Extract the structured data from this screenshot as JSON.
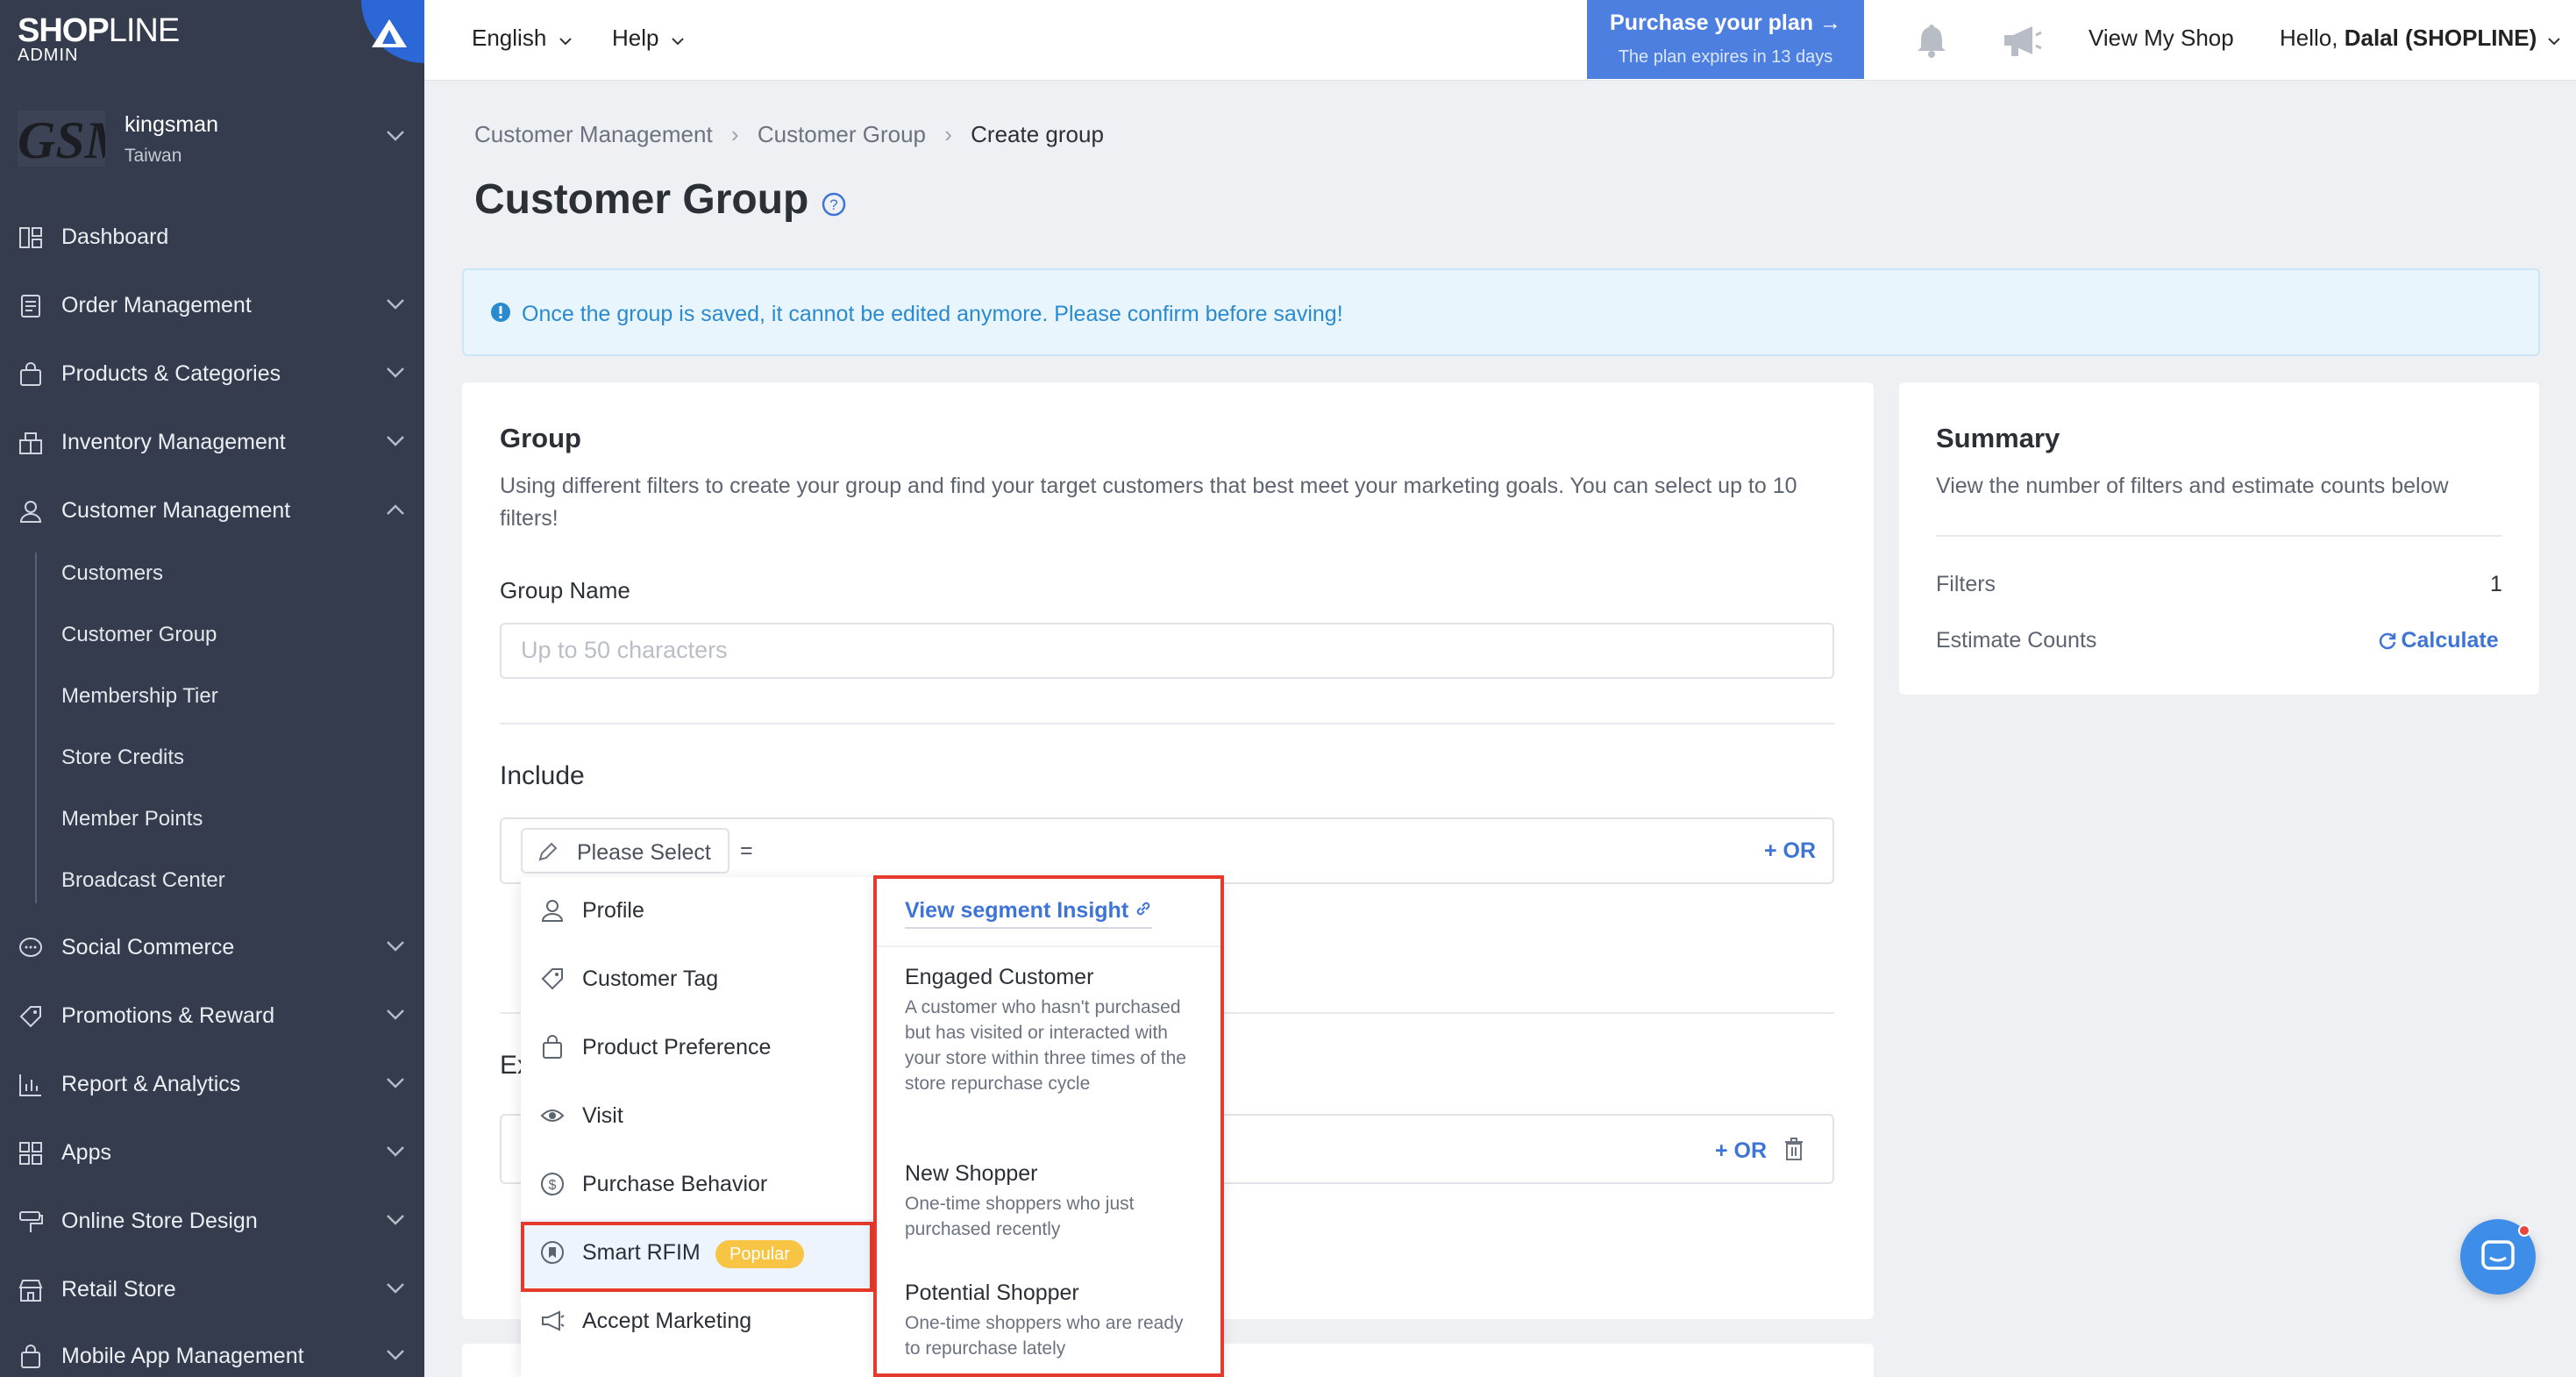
{
  "brand": {
    "logo_bold": "SHOP",
    "logo_light": "LINE",
    "sub": "ADMIN"
  },
  "store": {
    "logo_text": "GSM",
    "name": "kingsman",
    "country": "Taiwan"
  },
  "sidebar": {
    "items": [
      {
        "label": "Dashboard",
        "icon": "dashboard-icon"
      },
      {
        "label": "Order Management",
        "icon": "order-icon"
      },
      {
        "label": "Products & Categories",
        "icon": "bag-icon"
      },
      {
        "label": "Inventory Management",
        "icon": "inventory-icon"
      },
      {
        "label": "Customer Management",
        "icon": "user-icon"
      },
      {
        "label": "Social Commerce",
        "icon": "chat-icon"
      },
      {
        "label": "Promotions & Reward",
        "icon": "tag-icon"
      },
      {
        "label": "Report & Analytics",
        "icon": "chart-icon"
      },
      {
        "label": "Apps",
        "icon": "apps-icon"
      },
      {
        "label": "Online Store Design",
        "icon": "paint-icon"
      },
      {
        "label": "Retail Store",
        "icon": "store-icon"
      },
      {
        "label": "Mobile App Management",
        "icon": "mobile-icon"
      }
    ],
    "sub_items": [
      "Customers",
      "Customer Group",
      "Membership Tier",
      "Store Credits",
      "Member Points",
      "Broadcast Center"
    ]
  },
  "topbar": {
    "language": "English",
    "help": "Help",
    "purchase_title": "Purchase your plan →",
    "purchase_sub": "The plan expires in 13 days",
    "view_shop": "View My Shop",
    "greeting_prefix": "Hello,",
    "greeting_name": "Dalal (SHOPLINE)"
  },
  "breadcrumb": {
    "level1": "Customer Management",
    "level2": "Customer Group",
    "current": "Create group"
  },
  "page_title": "Customer Group",
  "alert": "Once the group is saved, it cannot be edited anymore. Please confirm before saving!",
  "group_card": {
    "title": "Group",
    "description": "Using different filters to create your group and find your target customers that best meet your marketing goals. You can select up to 10 filters!",
    "name_label": "Group Name",
    "name_placeholder": "Up to 50 characters",
    "include_label": "Include",
    "exclude_label_partial": "Ex",
    "select_label": "Please Select",
    "equals": "=",
    "or_label": "+ OR"
  },
  "dropdown": {
    "items": [
      "Profile",
      "Customer Tag",
      "Product Preference",
      "Visit",
      "Purchase Behavior",
      "Smart RFIM",
      "Accept Marketing"
    ],
    "badge": "Popular",
    "segment_link": "View segment Insight",
    "segments": [
      {
        "title": "Engaged Customer",
        "desc": "A customer who hasn't purchased but has visited or interacted with your store within three times of the store repurchase cycle"
      },
      {
        "title": "New Shopper",
        "desc": "One-time shoppers who just purchased recently"
      },
      {
        "title": "Potential Shopper",
        "desc": "One-time shoppers who are ready to repurchase lately"
      }
    ]
  },
  "summary": {
    "title": "Summary",
    "description": "View the number of filters and estimate counts below",
    "filters_label": "Filters",
    "filters_value": "1",
    "estimate_label": "Estimate Counts",
    "calculate": "Calculate"
  },
  "colors": {
    "sidebar": "#343c4d",
    "accent": "#3e74d6",
    "highlight": "#e53a2b",
    "badge": "#f7c443"
  }
}
